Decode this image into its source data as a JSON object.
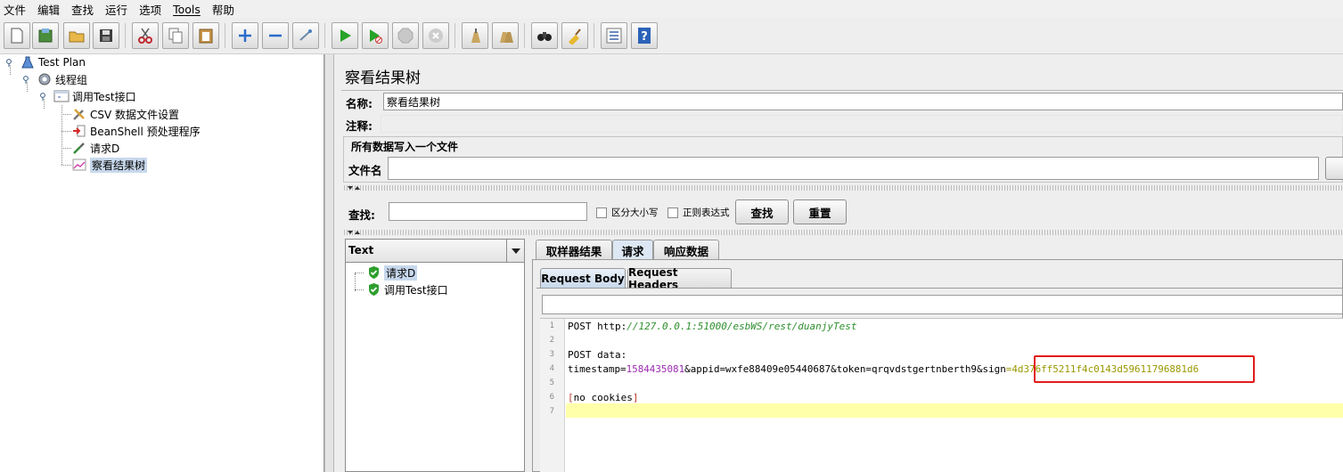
{
  "menu": [
    "文件",
    "编辑",
    "查找",
    "运行",
    "选项",
    "Tools",
    "帮助"
  ],
  "toolbar": {
    "icons": [
      "new-icon",
      "templates-icon",
      "open-icon",
      "save-icon",
      "cut-icon",
      "copy-icon",
      "paste-icon",
      "expand-icon",
      "collapse-icon",
      "toggle-icon",
      "start-icon",
      "start-no-pauses-icon",
      "stop-icon",
      "shutdown-icon",
      "clear-icon",
      "clear-all-icon",
      "search-icon",
      "reset-search-icon",
      "function-helper-icon",
      "help-icon"
    ]
  },
  "tree": {
    "items": [
      {
        "label": "Test Plan"
      },
      {
        "label": "线程组"
      },
      {
        "label": "调用Test接口"
      },
      {
        "label": "CSV 数据文件设置"
      },
      {
        "label": "BeanShell 预处理程序"
      },
      {
        "label": "请求D"
      },
      {
        "label": "察看结果树"
      }
    ]
  },
  "panel": {
    "title": "察看结果树",
    "name_label": "名称:",
    "name_value": "察看结果树",
    "comment_label": "注释:",
    "comment_value": "",
    "group_title": "所有数据写入一个文件",
    "filename_label": "文件名",
    "filename_value": ""
  },
  "search": {
    "label": "查找:",
    "value": "",
    "case_sensitive": "区分大小写",
    "regex": "正则表达式",
    "find_button": "查找",
    "reset_button": "重置"
  },
  "results": {
    "renderer": "Text",
    "items": [
      {
        "label": "请求D",
        "status": "success"
      },
      {
        "label": "调用Test接口",
        "status": "success"
      }
    ]
  },
  "tabs": [
    "取样器结果",
    "请求",
    "响应数据"
  ],
  "active_tab": "请求",
  "subtabs": [
    "Request Body",
    "Request Headers"
  ],
  "active_subtab": "Request Body",
  "editor": {
    "line_numbers": [
      "1",
      "2",
      "3",
      "4",
      "5",
      "6",
      "7"
    ],
    "line1_prefix": "POST http:",
    "line1_url": "//127.0.0.1:51000/esbWS/rest/duanjyTest",
    "line3": "POST data:",
    "line4_a": "timestamp=",
    "line4_ts": "1584435081",
    "line4_b": "&appid=wxfe88409e05440687&token=qrqvdstgertnberth9&sign",
    "line4_sig": "=4d376ff5211f4c0143d59611796881d6",
    "line6_open": "[",
    "line6_text": "no cookies",
    "line6_close": "]"
  },
  "colors": {
    "highlight_box": "#e21b1b",
    "current_line": "#ffffaa",
    "url_text": "#2f8f2f",
    "number_text": "#9b2bb0",
    "success_shield": "#2e9e2e",
    "selected_node": "#c8d8ec"
  }
}
